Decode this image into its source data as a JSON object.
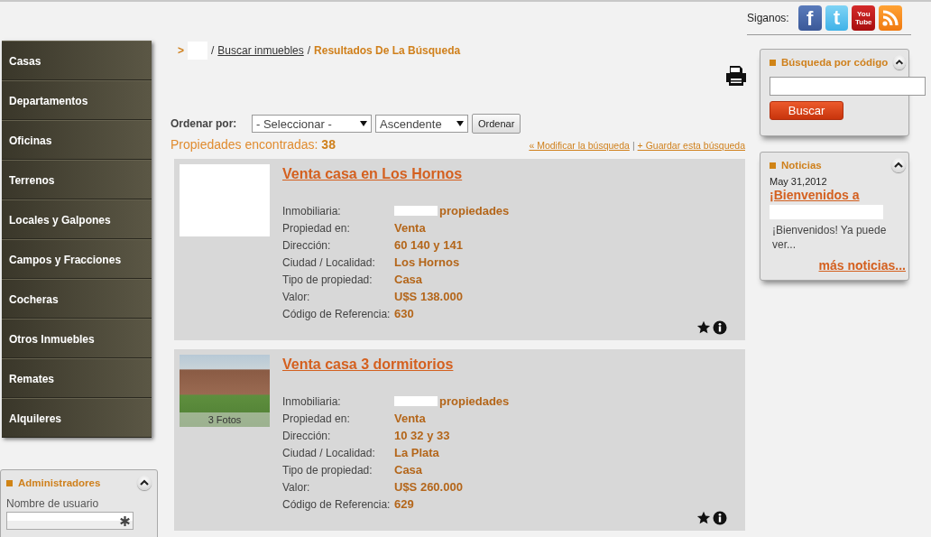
{
  "menu": {
    "items": [
      "Casas",
      "Departamentos",
      "Oficinas",
      "Terrenos",
      "Locales y Galpones",
      "Campos y Fracciones",
      "Cocheras",
      "Otros Inmuebles",
      "Remates",
      "Alquileres"
    ]
  },
  "admin_panel": {
    "title": "Administradores",
    "username_label": "Nombre de usuario"
  },
  "breadcrumb": {
    "separator": ">",
    "item_separator": "/",
    "items": [
      {
        "label": "Buscar inmuebles",
        "kind": "link"
      },
      {
        "label": "Resultados De La Búsqueda",
        "kind": "current"
      }
    ]
  },
  "sort": {
    "label": "Ordenar por:",
    "field_select": "- Seleccionar -",
    "direction_select": "Ascendente",
    "button": "Ordenar"
  },
  "results": {
    "label": "Propiedades encontradas:",
    "count": "38",
    "links": [
      "« Modificar la búsqueda",
      "+ Guardar esta búsqueda"
    ],
    "link_separator": "|"
  },
  "properties": [
    {
      "title": "Venta casa en Los Hornos",
      "photo": {
        "kind": "blank"
      },
      "fields": [
        {
          "label": "Inmobiliaria:",
          "value": "propiedades",
          "redacted": true
        },
        {
          "label": "Propiedad en:",
          "value": "Venta",
          "redacted": false
        },
        {
          "label": "Dirección:",
          "value": "60 140 y 141",
          "redacted": false
        },
        {
          "label": "Ciudad / Localidad:",
          "value": "Los Hornos",
          "redacted": false
        },
        {
          "label": "Tipo de propiedad:",
          "value": "Casa",
          "redacted": false
        },
        {
          "label": "Valor:",
          "value": "U$S 138.000",
          "redacted": false
        },
        {
          "label": "Código de Referencia:",
          "value": "630",
          "redacted": false
        }
      ]
    },
    {
      "title": "Venta casa 3 dormitorios",
      "photo": {
        "kind": "photo",
        "caption": "3 Fotos"
      },
      "fields": [
        {
          "label": "Inmobiliaria:",
          "value": "propiedades",
          "redacted": true
        },
        {
          "label": "Propiedad en:",
          "value": "Venta",
          "redacted": false
        },
        {
          "label": "Dirección:",
          "value": "10 32 y 33",
          "redacted": false
        },
        {
          "label": "Ciudad / Localidad:",
          "value": "La Plata",
          "redacted": false
        },
        {
          "label": "Tipo de propiedad:",
          "value": "Casa",
          "redacted": false
        },
        {
          "label": "Valor:",
          "value": "U$S 260.000",
          "redacted": false
        },
        {
          "label": "Código de Referencia:",
          "value": "629",
          "redacted": false
        }
      ]
    }
  ],
  "social": {
    "label": "Siganos:",
    "icons": [
      {
        "kind": "facebook",
        "glyph": "f"
      },
      {
        "kind": "twitter",
        "glyph": "t"
      },
      {
        "kind": "youtube",
        "lines": [
          "You",
          "Tube"
        ]
      },
      {
        "kind": "rss"
      }
    ]
  },
  "code_search": {
    "title": "Búsqueda por código",
    "button": "Buscar"
  },
  "news": {
    "title": "Noticias",
    "date": "May 31,2012",
    "headline": "¡Bienvenidos a",
    "excerpt": "¡Bienvenidos! Ya puede ver...",
    "more": "más noticias..."
  }
}
